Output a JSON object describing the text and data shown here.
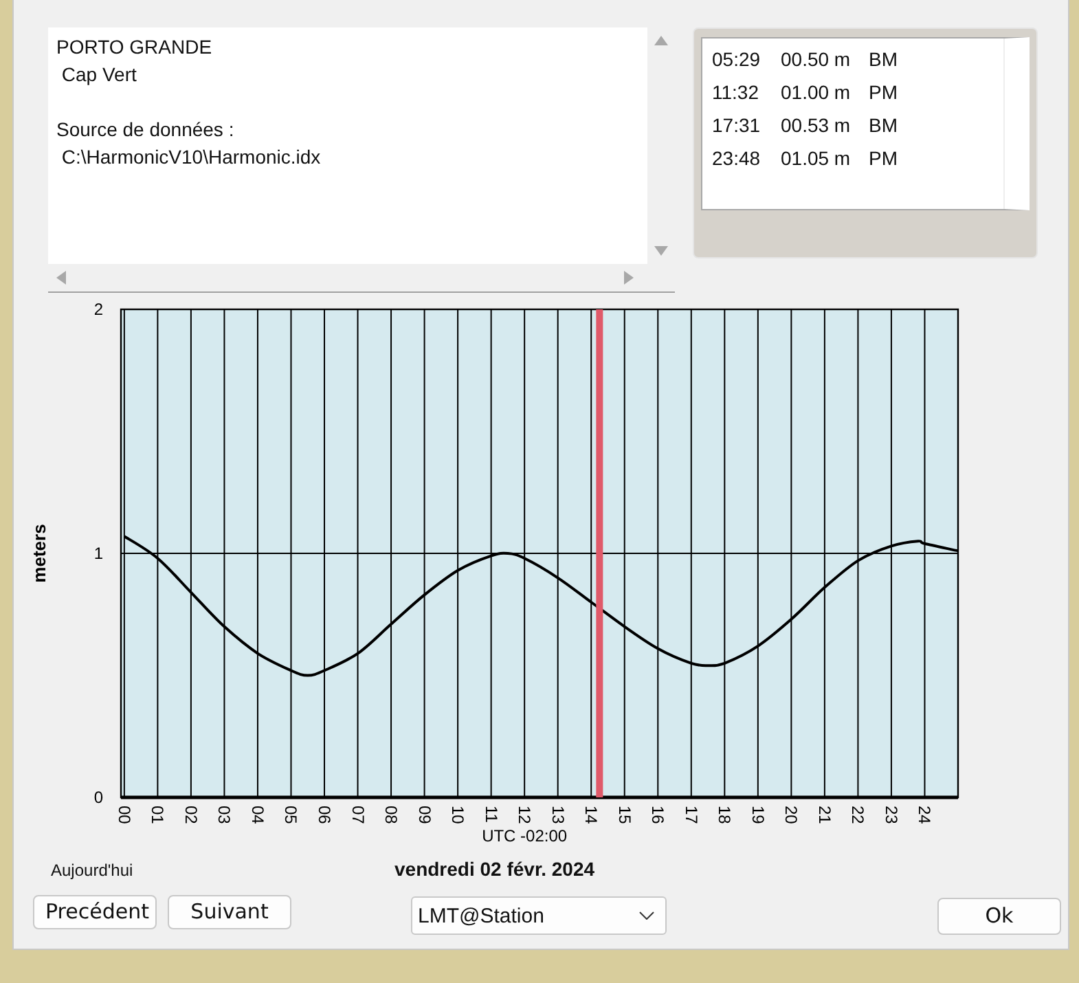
{
  "info_panel": {
    "paragraphs": [
      [
        "PORTO GRANDE",
        " Cap Vert"
      ],
      [
        "Source de données :",
        " C:\\HarmonicV10\\Harmonic.idx"
      ]
    ]
  },
  "tides": [
    {
      "time": "05:29",
      "height": "00.50 m",
      "type": "BM"
    },
    {
      "time": "11:32",
      "height": "01.00 m",
      "type": "PM"
    },
    {
      "time": "17:31",
      "height": "00.53 m",
      "type": "BM"
    },
    {
      "time": "23:48",
      "height": "01.05 m",
      "type": "PM"
    }
  ],
  "chart": {
    "chart_data": {
      "type": "line",
      "ylabel": "meters",
      "xlabel": "UTC -02:00",
      "xlim": [
        -0.1,
        25
      ],
      "ylim": [
        0,
        2
      ],
      "yticks": [
        0,
        1,
        2
      ],
      "xticks": [
        {
          "value": 0,
          "label": "00"
        },
        {
          "value": 1,
          "label": "01"
        },
        {
          "value": 2,
          "label": "02"
        },
        {
          "value": 3,
          "label": "03"
        },
        {
          "value": 4,
          "label": "04"
        },
        {
          "value": 5,
          "label": "05"
        },
        {
          "value": 6,
          "label": "06"
        },
        {
          "value": 7,
          "label": "07"
        },
        {
          "value": 8,
          "label": "08"
        },
        {
          "value": 9,
          "label": "09"
        },
        {
          "value": 10,
          "label": "10"
        },
        {
          "value": 11,
          "label": "11"
        },
        {
          "value": 12,
          "label": "12"
        },
        {
          "value": 13,
          "label": "13"
        },
        {
          "value": 14,
          "label": "14"
        },
        {
          "value": 15,
          "label": "15"
        },
        {
          "value": 16,
          "label": "16"
        },
        {
          "value": 17,
          "label": "17"
        },
        {
          "value": 18,
          "label": "18"
        },
        {
          "value": 19,
          "label": "19"
        },
        {
          "value": 20,
          "label": "20"
        },
        {
          "value": 21,
          "label": "21"
        },
        {
          "value": 22,
          "label": "22"
        },
        {
          "value": 23,
          "label": "23"
        },
        {
          "value": 24,
          "label": "24"
        }
      ],
      "x": [
        0,
        1,
        2,
        3,
        4,
        5,
        5.5,
        6,
        7,
        8,
        9,
        10,
        11,
        11.5,
        12,
        13,
        14,
        15,
        16,
        17,
        17.5,
        18,
        19,
        20,
        21,
        22,
        23,
        23.8,
        24,
        25
      ],
      "grid": true,
      "series": [
        {
          "color": "#000000",
          "values": [
            1.07,
            0.98,
            0.84,
            0.7,
            0.59,
            0.52,
            0.5,
            0.52,
            0.59,
            0.71,
            0.83,
            0.93,
            0.99,
            1.0,
            0.98,
            0.9,
            0.8,
            0.7,
            0.61,
            0.55,
            0.54,
            0.55,
            0.62,
            0.73,
            0.86,
            0.97,
            1.03,
            1.05,
            1.04,
            1.01
          ]
        }
      ],
      "ref_lines": [
        {
          "axis": "x",
          "value": 14.25,
          "color": "#e05a6a"
        }
      ]
    }
  },
  "today_label": "Aujourd'hui",
  "date": "vendredi 02 févr. 2024",
  "buttons": {
    "previous": "Precédent",
    "next": "Suivant",
    "ok": "Ok"
  },
  "timezone_select": {
    "value": "LMT@Station"
  }
}
